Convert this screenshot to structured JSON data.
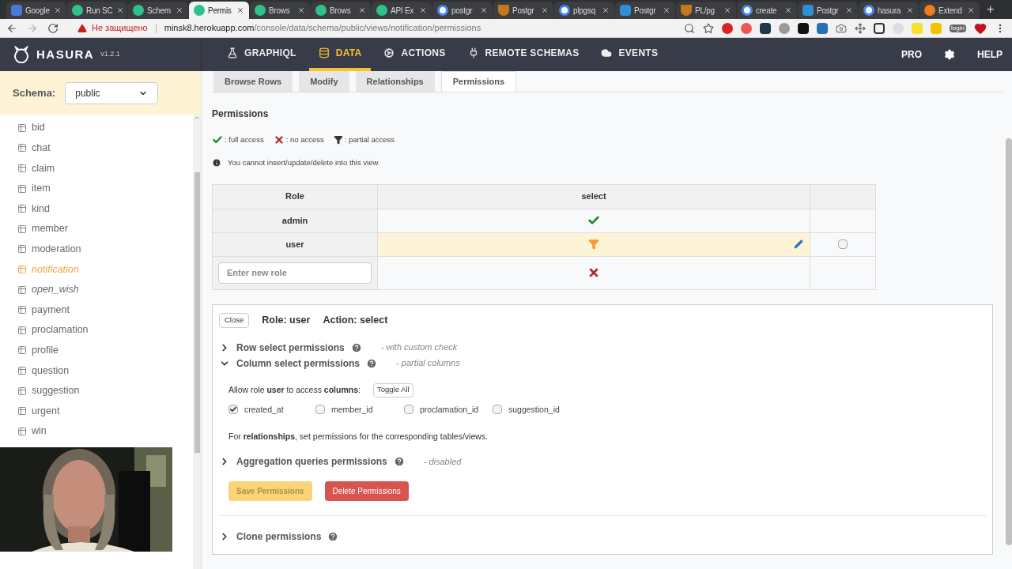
{
  "browser": {
    "tabs": [
      {
        "title": "Google",
        "kind": "docs",
        "selected": false
      },
      {
        "title": "Run SC",
        "kind": "hasura",
        "selected": false
      },
      {
        "title": "Schem",
        "kind": "hasura",
        "selected": false
      },
      {
        "title": "Permis",
        "kind": "hasura",
        "selected": true
      },
      {
        "title": "Brows",
        "kind": "hasura",
        "selected": false
      },
      {
        "title": "Brows",
        "kind": "hasura",
        "selected": false
      },
      {
        "title": "API Ex",
        "kind": "hasura",
        "selected": false
      },
      {
        "title": "postgr",
        "kind": "google",
        "selected": false
      },
      {
        "title": "Postgr",
        "kind": "shield",
        "selected": false
      },
      {
        "title": "plpgsq",
        "kind": "google",
        "selected": false
      },
      {
        "title": "Postgr",
        "kind": "help",
        "selected": false
      },
      {
        "title": "PL/pg",
        "kind": "shield",
        "selected": false
      },
      {
        "title": "create",
        "kind": "google",
        "selected": false
      },
      {
        "title": "Postgr",
        "kind": "help",
        "selected": false
      },
      {
        "title": "hasura",
        "kind": "google",
        "selected": false
      },
      {
        "title": "Extend",
        "kind": "fire",
        "selected": false
      }
    ],
    "new_tab": "+",
    "security": "Не защищено",
    "url_host": "minsk8.herokuapp.com",
    "url_path": "/console/data/schema/public/views/notification/permissions",
    "extension_badge": "login"
  },
  "header": {
    "logo": "HASURA",
    "version": "v1.2.1",
    "nav": [
      {
        "label": "GRAPHIQL",
        "kind": "flask",
        "selected": false
      },
      {
        "label": "DATA",
        "kind": "database",
        "selected": true
      },
      {
        "label": "ACTIONS",
        "kind": "cogs",
        "selected": false
      },
      {
        "label": "REMOTE SCHEMAS",
        "kind": "plug",
        "selected": false
      },
      {
        "label": "EVENTS",
        "kind": "cloud",
        "selected": false
      }
    ],
    "pro": "PRO",
    "help": "HELP"
  },
  "sidebar": {
    "schema_label": "Schema:",
    "schema_value": "public",
    "tables": [
      {
        "name": "bid",
        "kind": "table",
        "selected": false
      },
      {
        "name": "chat",
        "kind": "table",
        "selected": false
      },
      {
        "name": "claim",
        "kind": "table",
        "selected": false
      },
      {
        "name": "item",
        "kind": "table",
        "selected": false
      },
      {
        "name": "kind",
        "kind": "table",
        "selected": false
      },
      {
        "name": "member",
        "kind": "table",
        "selected": false
      },
      {
        "name": "moderation",
        "kind": "table",
        "selected": false
      },
      {
        "name": "notification",
        "kind": "view",
        "selected": true
      },
      {
        "name": "open_wish",
        "kind": "view",
        "selected": false
      },
      {
        "name": "payment",
        "kind": "table",
        "selected": false
      },
      {
        "name": "proclamation",
        "kind": "table",
        "selected": false
      },
      {
        "name": "profile",
        "kind": "table",
        "selected": false
      },
      {
        "name": "question",
        "kind": "table",
        "selected": false
      },
      {
        "name": "suggestion",
        "kind": "table",
        "selected": false
      },
      {
        "name": "urgent",
        "kind": "table",
        "selected": false
      },
      {
        "name": "win",
        "kind": "table",
        "selected": false
      }
    ]
  },
  "subtabs": [
    {
      "label": "Browse Rows",
      "selected": false
    },
    {
      "label": "Modify",
      "selected": false
    },
    {
      "label": "Relationships",
      "selected": false
    },
    {
      "label": "Permissions",
      "selected": true
    }
  ],
  "permissions": {
    "title": "Permissions",
    "legend": [
      {
        "kind": "full",
        "label": ": full access"
      },
      {
        "kind": "none",
        "label": ": no access"
      },
      {
        "kind": "partial",
        "label": ": partial access"
      }
    ],
    "note": "You cannot insert/update/delete into this view",
    "columns": [
      "Role",
      "select"
    ],
    "rows": [
      {
        "role": "admin",
        "kind": "full",
        "selected": false
      },
      {
        "role": "user",
        "kind": "partial",
        "selected": true,
        "checked": false
      }
    ],
    "new_role": {
      "placeholder": "Enter new role",
      "kind": "none"
    }
  },
  "editor": {
    "close": "Close",
    "role": "Role: user",
    "action": "Action: select",
    "sections": [
      {
        "title": "Row select permissions",
        "note": "- with custom check",
        "expanded": false
      },
      {
        "title": "Column select permissions",
        "note": "- partial columns",
        "expanded": true
      },
      {
        "title": "Aggregation queries permissions",
        "note": "- disabled",
        "expanded": false
      }
    ],
    "allow_text": "Allow role **user** to access **columns**:",
    "toggle": "Toggle All",
    "columns": [
      {
        "name": "created_at",
        "checked": true
      },
      {
        "name": "member_id",
        "checked": false
      },
      {
        "name": "proclamation_id",
        "checked": false
      },
      {
        "name": "suggestion_id",
        "checked": false
      }
    ],
    "relationships_text": "For **relationships**, set permissions for the corresponding tables/views.",
    "save": {
      "label": "Save Permissions",
      "disabled": true
    },
    "delete": "Delete Permissions",
    "clone": {
      "title": "Clone permissions",
      "expanded": false
    }
  }
}
